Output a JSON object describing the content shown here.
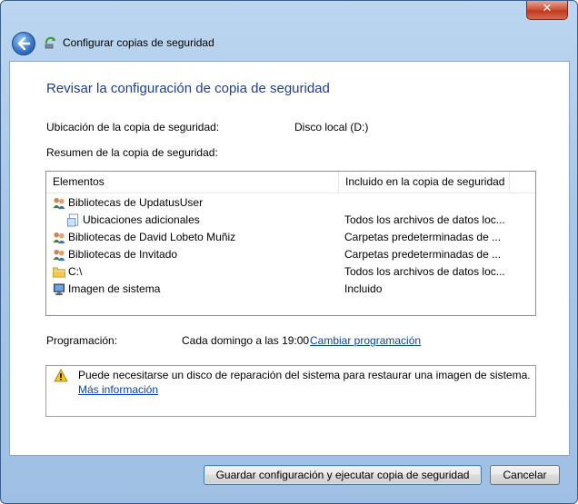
{
  "window": {
    "title": "Configurar copias de seguridad",
    "close_label": "✕"
  },
  "page": {
    "heading": "Revisar la configuración de copia de seguridad",
    "location_label": "Ubicación de la copia de seguridad:",
    "location_value": "Disco local (D:)",
    "summary_label": "Resumen de la copia de seguridad:"
  },
  "table": {
    "columns": [
      "Elementos",
      "Incluido en la copia de seguridad"
    ],
    "rows": [
      {
        "name": "Bibliotecas de UpdatusUser",
        "included": "",
        "icon": "users-library-icon"
      },
      {
        "name": "Ubicaciones adicionales",
        "included": "Todos los archivos de datos loc...",
        "icon": "document-folder-icon"
      },
      {
        "name": "Bibliotecas de David Lobeto Muñiz",
        "included": "Carpetas predeterminadas de ...",
        "icon": "users-library-icon"
      },
      {
        "name": "Bibliotecas de Invitado",
        "included": "Carpetas predeterminadas de ...",
        "icon": "users-library-icon"
      },
      {
        "name": "C:\\",
        "included": "Todos los archivos de datos loc...",
        "icon": "folder-icon"
      },
      {
        "name": "Imagen de sistema",
        "included": "Incluido",
        "icon": "computer-icon"
      }
    ]
  },
  "schedule": {
    "label": "Programación:",
    "value": "Cada domingo a las 19:00",
    "change_link": "Cambiar programación"
  },
  "notice": {
    "text": "Puede necesitarse un disco de reparación del sistema para restaurar una imagen de sistema.",
    "more_link": "Más información"
  },
  "buttons": {
    "save": "Guardar configuración y ejecutar copia de seguridad",
    "cancel": "Cancelar"
  }
}
